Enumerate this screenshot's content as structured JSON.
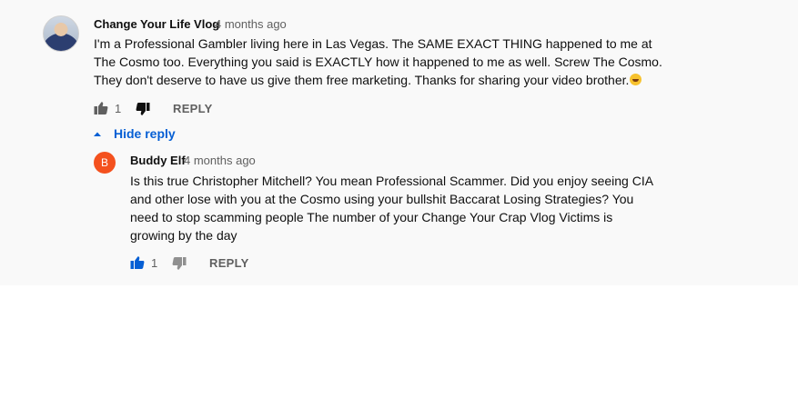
{
  "comment": {
    "author": "Change Your Life Vlog",
    "time": "4 months ago",
    "text_lines": [
      "I'm a Professional Gambler living here in Las Vegas. The SAME EXACT THING happened to me at",
      "The Cosmo too. Everything you said is EXACTLY how it happened to me as well. Screw The Cosmo.",
      "They don't deserve to have us give them free marketing. Thanks for sharing your video brother."
    ],
    "emoji": "smiling-face-emoji",
    "likes": "1",
    "reply_label": "REPLY",
    "hide_replies_label": "Hide reply"
  },
  "reply": {
    "avatar_letter": "B",
    "avatar_color": "#f4511e",
    "author": "Buddy Elf",
    "time": "4 months ago",
    "text_lines": [
      "Is this true Christopher Mitchell?  You mean Professional Scammer. Did you enjoy seeing CIA",
      "and other lose with you at the Cosmo using your bullshit Baccarat Losing Strategies?  You",
      "need to stop scamming people The number of your Change Your Crap Vlog Victims is",
      "growing by the day"
    ],
    "likes": "1",
    "reply_label": "REPLY"
  },
  "colors": {
    "link_blue": "#065fd4",
    "secondary_text": "#606060",
    "like_active": "#065fd4",
    "icon_dark": "#0f0f0f"
  }
}
